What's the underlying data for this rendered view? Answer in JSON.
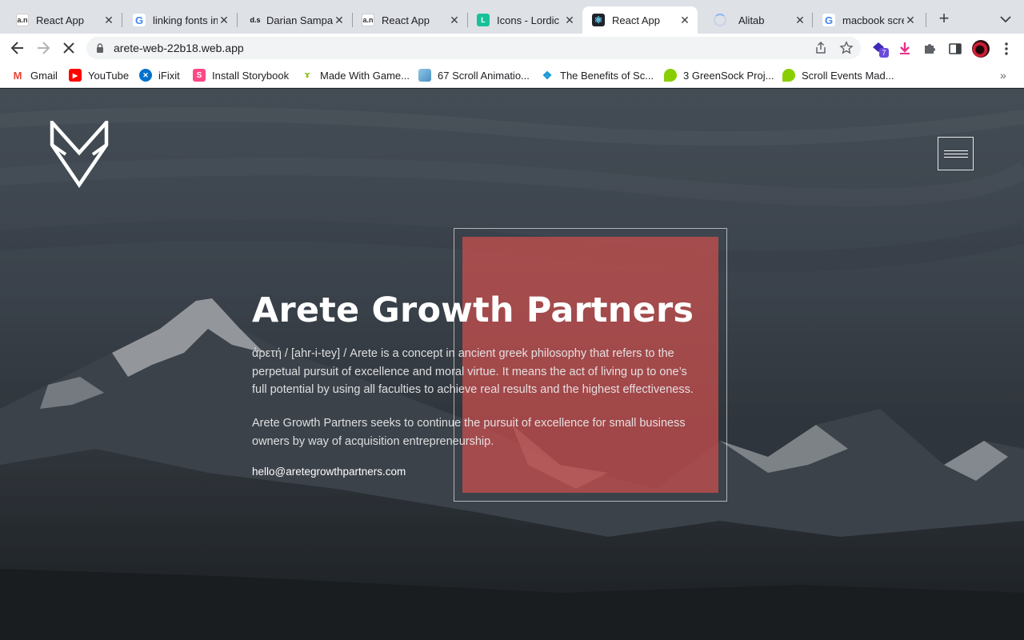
{
  "browser": {
    "tabs": [
      {
        "title": "React App",
        "favicon": "a.n",
        "favicon_name": "an-favicon-icon"
      },
      {
        "title": "linking fonts in",
        "favicon": "G",
        "favicon_name": "google-icon"
      },
      {
        "title": "Darian Sampa",
        "favicon": "d.s",
        "favicon_name": "ds-favicon-icon"
      },
      {
        "title": "React App",
        "favicon": "a.n",
        "favicon_name": "an-favicon-icon"
      },
      {
        "title": "Icons - Lordic",
        "favicon": "L",
        "favicon_name": "lordicon-icon"
      },
      {
        "title": "React App",
        "favicon": "⚛",
        "favicon_name": "react-icon"
      },
      {
        "title": "Alitab",
        "favicon": "",
        "favicon_name": "loading-spinner-icon"
      },
      {
        "title": "macbook scre",
        "favicon": "G",
        "favicon_name": "google-icon"
      }
    ],
    "active_tab": 5,
    "close_glyph": "✕",
    "new_tab_glyph": "+",
    "url": "arete-web-22b18.web.app",
    "extension_badge": "7",
    "bookmarks": [
      {
        "label": "Gmail",
        "icon": "gmail-icon"
      },
      {
        "label": "YouTube",
        "icon": "youtube-icon"
      },
      {
        "label": "iFixit",
        "icon": "ifixit-icon"
      },
      {
        "label": "Install Storybook",
        "icon": "storybook-icon"
      },
      {
        "label": "Made With Game...",
        "icon": "gamemaker-icon"
      },
      {
        "label": "67 Scroll Animatio...",
        "icon": "image-icon"
      },
      {
        "label": "The Benefits of Sc...",
        "icon": "diamond-icon"
      },
      {
        "label": "3 GreenSock Proj...",
        "icon": "greensock-icon"
      },
      {
        "label": "Scroll Events Mad...",
        "icon": "greensock-icon"
      }
    ],
    "bookmarks_overflow": "»"
  },
  "page": {
    "title": "Arete Growth Partners",
    "intro": "ἀρετή / [ahr-i-tey] / Arete is a concept in ancient greek philosophy that refers to the perpetual pursuit of excellence and moral virtue. It means the act of living up to one’s full potential by using all faculties to achieve real results and the highest effectiveness.",
    "mission": "Arete Growth Partners seeks to continue the pursuit of excellence for small business owners by way of acquisition entrepreneurship.",
    "email": "hello@aretegrowthpartners.com"
  },
  "colors": {
    "accent_red": "#d2504e",
    "tab_strip": "#dee1e6"
  }
}
